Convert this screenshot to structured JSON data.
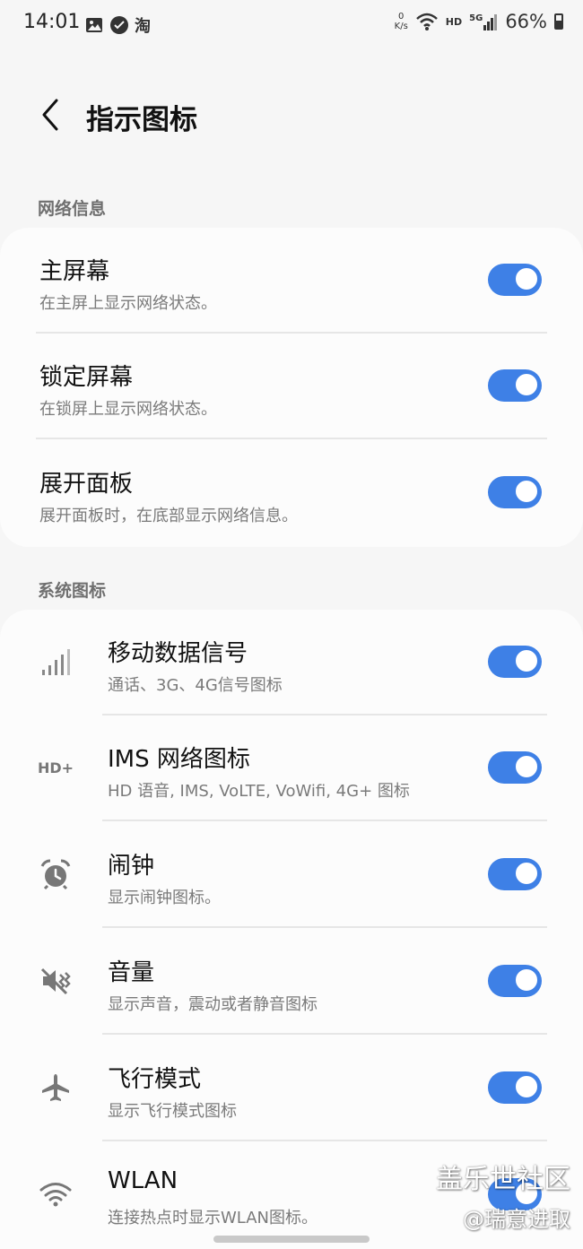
{
  "status_bar": {
    "time": "14:01",
    "app_badge": "淘",
    "speed_value": "0",
    "speed_unit": "K/s",
    "hd": "HD",
    "network": "5G",
    "battery": "66%"
  },
  "header": {
    "title": "指示图标"
  },
  "sections": {
    "network": {
      "label": "网络信息",
      "items": [
        {
          "title": "主屏幕",
          "subtitle": "在主屏上显示网络状态。",
          "enabled": true
        },
        {
          "title": "锁定屏幕",
          "subtitle": "在锁屏上显示网络状态。",
          "enabled": true
        },
        {
          "title": "展开面板",
          "subtitle": "展开面板时，在底部显示网络信息。",
          "enabled": true
        }
      ]
    },
    "system": {
      "label": "系统图标",
      "items": [
        {
          "icon": "signal-bars-icon",
          "title": "移动数据信号",
          "subtitle": "通话、3G、4G信号图标",
          "enabled": true
        },
        {
          "icon": "hd-plus-icon",
          "icon_text": "HD+",
          "title": "IMS 网络图标",
          "subtitle": "HD 语音, IMS, VoLTE, VoWifi, 4G+ 图标",
          "enabled": true
        },
        {
          "icon": "alarm-clock-icon",
          "title": "闹钟",
          "subtitle": "显示闹钟图标。",
          "enabled": true
        },
        {
          "icon": "volume-mute-icon",
          "title": "音量",
          "subtitle": "显示声音，震动或者静音图标",
          "enabled": true
        },
        {
          "icon": "airplane-icon",
          "title": "飞行模式",
          "subtitle": "显示飞行模式图标",
          "enabled": true
        },
        {
          "icon": "wifi-icon",
          "title": "WLAN",
          "subtitle": "连接热点时显示WLAN图标。",
          "enabled": true
        }
      ]
    }
  },
  "watermark": {
    "line1": "盖乐世社区",
    "line2": "@瑞意进取"
  },
  "colors": {
    "accent": "#3e80e6",
    "background": "#f6f6f6",
    "card": "#fcfcfc"
  }
}
